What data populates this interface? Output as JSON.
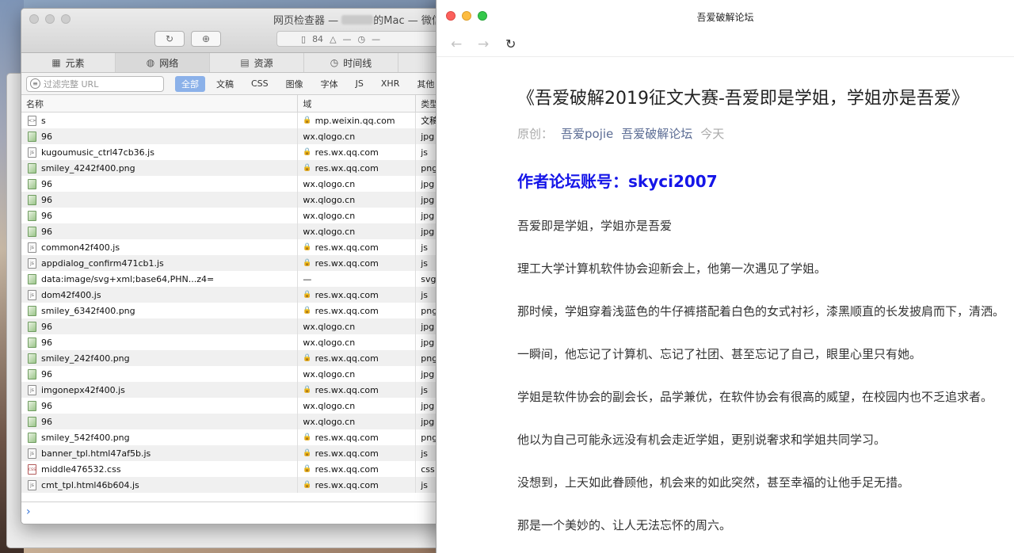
{
  "inspector": {
    "title_prefix": "网页检查器 — ",
    "title_suffix": "的Mac — 微信",
    "resource_count": "84",
    "errors": "—",
    "load_time": "—",
    "tabs": [
      {
        "label": "元素",
        "icon": "elements-icon"
      },
      {
        "label": "网络",
        "icon": "network-icon"
      },
      {
        "label": "资源",
        "icon": "resources-icon"
      },
      {
        "label": "时间线",
        "icon": "timeline-icon"
      }
    ],
    "filter_placeholder": "过滤完整 URL",
    "filters": [
      "全部",
      "文稿",
      "CSS",
      "图像",
      "字体",
      "JS",
      "XHR",
      "其他"
    ],
    "columns": {
      "name": "名称",
      "domain": "域",
      "type": "类型"
    },
    "rows": [
      {
        "name": "s",
        "domain": "mp.weixin.qq.com",
        "type": "文稿",
        "secure": true,
        "kind": "doc"
      },
      {
        "name": "96",
        "domain": "wx.qlogo.cn",
        "type": "jpg",
        "secure": false,
        "kind": "img"
      },
      {
        "name": "kugoumusic_ctrl47cb36.js",
        "domain": "res.wx.qq.com",
        "type": "js",
        "secure": true,
        "kind": "js"
      },
      {
        "name": "smiley_4242f400.png",
        "domain": "res.wx.qq.com",
        "type": "png",
        "secure": true,
        "kind": "img"
      },
      {
        "name": "96",
        "domain": "wx.qlogo.cn",
        "type": "jpg",
        "secure": false,
        "kind": "img"
      },
      {
        "name": "96",
        "domain": "wx.qlogo.cn",
        "type": "jpg",
        "secure": false,
        "kind": "img"
      },
      {
        "name": "96",
        "domain": "wx.qlogo.cn",
        "type": "jpg",
        "secure": false,
        "kind": "img"
      },
      {
        "name": "96",
        "domain": "wx.qlogo.cn",
        "type": "jpg",
        "secure": false,
        "kind": "img"
      },
      {
        "name": "common42f400.js",
        "domain": "res.wx.qq.com",
        "type": "js",
        "secure": true,
        "kind": "js"
      },
      {
        "name": "appdialog_confirm471cb1.js",
        "domain": "res.wx.qq.com",
        "type": "js",
        "secure": true,
        "kind": "js"
      },
      {
        "name": "data:image/svg+xml;base64,PHN...z4=",
        "domain": "—",
        "type": "svg",
        "secure": false,
        "kind": "img"
      },
      {
        "name": "dom42f400.js",
        "domain": "res.wx.qq.com",
        "type": "js",
        "secure": true,
        "kind": "js"
      },
      {
        "name": "smiley_6342f400.png",
        "domain": "res.wx.qq.com",
        "type": "png",
        "secure": true,
        "kind": "img"
      },
      {
        "name": "96",
        "domain": "wx.qlogo.cn",
        "type": "jpg",
        "secure": false,
        "kind": "img"
      },
      {
        "name": "96",
        "domain": "wx.qlogo.cn",
        "type": "jpg",
        "secure": false,
        "kind": "img"
      },
      {
        "name": "smiley_242f400.png",
        "domain": "res.wx.qq.com",
        "type": "png",
        "secure": true,
        "kind": "img"
      },
      {
        "name": "96",
        "domain": "wx.qlogo.cn",
        "type": "jpg",
        "secure": false,
        "kind": "img"
      },
      {
        "name": "imgonepx42f400.js",
        "domain": "res.wx.qq.com",
        "type": "js",
        "secure": true,
        "kind": "js"
      },
      {
        "name": "96",
        "domain": "wx.qlogo.cn",
        "type": "jpg",
        "secure": false,
        "kind": "img"
      },
      {
        "name": "96",
        "domain": "wx.qlogo.cn",
        "type": "jpg",
        "secure": false,
        "kind": "img"
      },
      {
        "name": "smiley_542f400.png",
        "domain": "res.wx.qq.com",
        "type": "png",
        "secure": true,
        "kind": "img"
      },
      {
        "name": "banner_tpl.html47af5b.js",
        "domain": "res.wx.qq.com",
        "type": "js",
        "secure": true,
        "kind": "js"
      },
      {
        "name": "middle476532.css",
        "domain": "res.wx.qq.com",
        "type": "css",
        "secure": true,
        "kind": "css"
      },
      {
        "name": "cmt_tpl.html46b604.js",
        "domain": "res.wx.qq.com",
        "type": "js",
        "secure": true,
        "kind": "js"
      }
    ]
  },
  "browser": {
    "title": "吾爱破解论坛",
    "article": {
      "title": "《吾爱破解2019征文大赛-吾爱即是学姐，学姐亦是吾爱》",
      "meta_original": "原创：",
      "meta_author": "吾爱pojie",
      "meta_account": "吾爱破解论坛",
      "meta_time": "今天",
      "author_line": "作者论坛账号：skyci2007",
      "paragraphs": [
        "吾爱即是学姐，学姐亦是吾爱",
        "理工大学计算机软件协会迎新会上，他第一次遇见了学姐。",
        "那时候，学姐穿着浅蓝色的牛仔裤搭配着白色的女式衬衫，漆黑顺直的长发披肩而下，清洒。",
        "一瞬间，他忘记了计算机、忘记了社团、甚至忘记了自己，眼里心里只有她。",
        "学姐是软件协会的副会长，品学兼优，在软件协会有很高的威望，在校园内也不乏追求者。",
        "他以为自己可能永远没有机会走近学姐，更别说奢求和学姐共同学习。",
        "没想到，上天如此眷顾他，机会来的如此突然，甚至幸福的让他手足无措。",
        "那是一个美妙的、让人无法忘怀的周六。"
      ]
    }
  }
}
